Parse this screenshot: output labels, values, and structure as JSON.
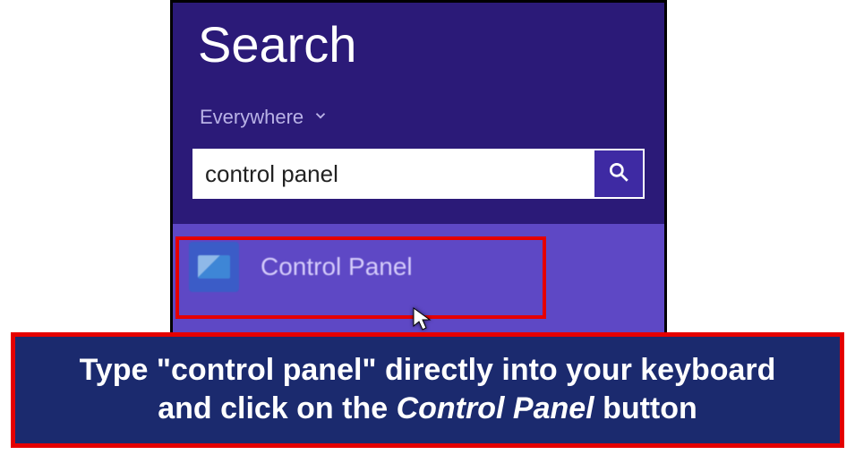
{
  "search": {
    "title": "Search",
    "scope_label": "Everywhere",
    "input_value": "control panel",
    "placeholder": ""
  },
  "results": {
    "items": [
      {
        "label": "Control Panel",
        "icon": "control-panel-icon"
      }
    ]
  },
  "instruction": {
    "line1": "Type \"control panel\" directly into your keyboard",
    "line2_prefix": "and click on the ",
    "line2_emph": "Control Panel",
    "line2_suffix": " button"
  },
  "colors": {
    "panel_bg": "#2b1a78",
    "results_bg": "#5e48c5",
    "accent": "#e50000",
    "banner_bg": "#1b2a6e"
  }
}
